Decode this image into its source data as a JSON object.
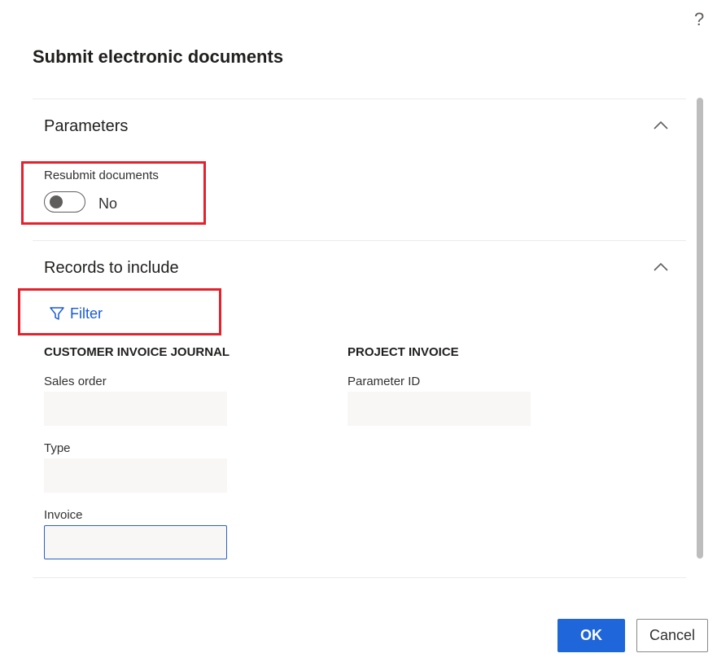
{
  "help": {
    "label": "?"
  },
  "dialog": {
    "title": "Submit electronic documents"
  },
  "parameters": {
    "title": "Parameters",
    "resubmit": {
      "label": "Resubmit documents",
      "value": "No",
      "checked": false
    }
  },
  "records": {
    "title": "Records to include",
    "filter_label": "Filter",
    "customer_invoice_journal": {
      "heading": "CUSTOMER INVOICE JOURNAL",
      "fields": [
        {
          "label": "Sales order",
          "value": ""
        },
        {
          "label": "Type",
          "value": ""
        },
        {
          "label": "Invoice",
          "value": ""
        }
      ]
    },
    "project_invoice": {
      "heading": "PROJECT INVOICE",
      "fields": [
        {
          "label": "Parameter ID",
          "value": ""
        }
      ]
    }
  },
  "footer": {
    "ok_label": "OK",
    "cancel_label": "Cancel"
  },
  "colors": {
    "accent": "#1e66d9",
    "highlight": "#e4212c",
    "link": "#1a5ad6"
  },
  "icons": [
    "question-icon",
    "chevron-up-icon",
    "filter-icon"
  ]
}
